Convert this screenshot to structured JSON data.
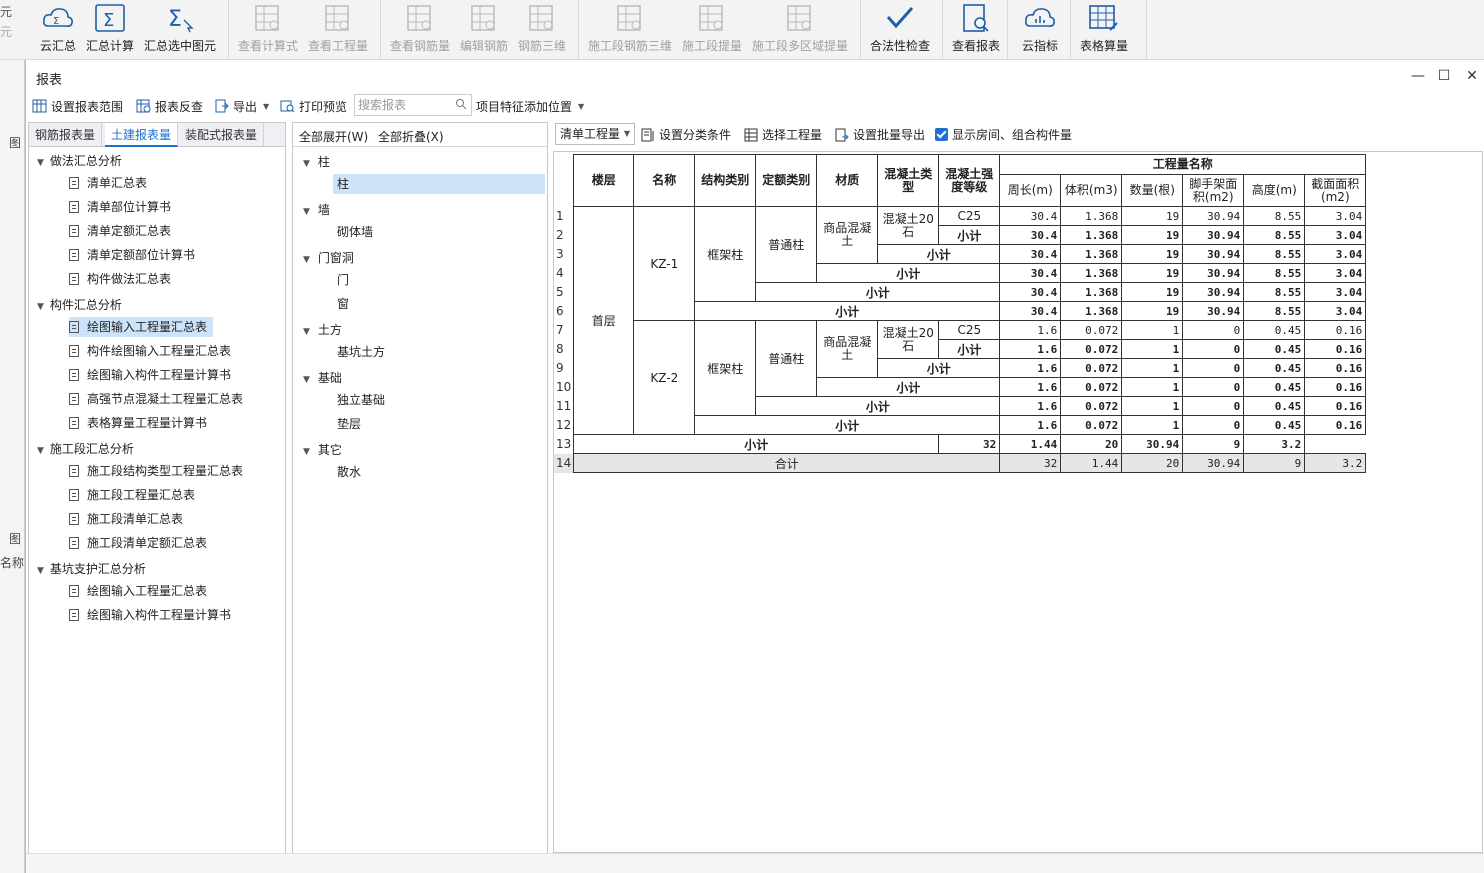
{
  "ribbon": {
    "edge_top": "元",
    "edge_bottom": "元",
    "buttons": [
      {
        "label": "云汇总",
        "icon": "cloud-sum-icon",
        "disabled": false
      },
      {
        "label": "汇总计算",
        "icon": "sigma-icon",
        "disabled": false
      },
      {
        "label": "汇总选中图元",
        "icon": "sigma-select-icon",
        "disabled": false
      },
      {
        "label": "查看计算式",
        "icon": "formula-view-icon",
        "disabled": true
      },
      {
        "label": "查看工程量",
        "icon": "quantity-view-icon",
        "disabled": true
      },
      {
        "label": "查看钢筋量",
        "icon": "rebar-view-icon",
        "disabled": true
      },
      {
        "label": "编辑钢筋",
        "icon": "edit-rebar-icon",
        "disabled": true
      },
      {
        "label": "钢筋三维",
        "icon": "rebar-3d-icon",
        "disabled": true
      },
      {
        "label": "施工段钢筋三维",
        "icon": "stage-rebar-3d-icon",
        "disabled": true
      },
      {
        "label": "施工段提量",
        "icon": "stage-quantity-icon",
        "disabled": true
      },
      {
        "label": "施工段多区域提量",
        "icon": "stage-multi-area-icon",
        "disabled": true
      },
      {
        "label": "合法性检查",
        "icon": "check-icon",
        "disabled": false
      },
      {
        "label": "查看报表",
        "icon": "report-view-icon",
        "disabled": false
      },
      {
        "label": "云指标",
        "icon": "cloud-index-icon",
        "disabled": false
      },
      {
        "label": "表格算量",
        "icon": "table-calc-icon",
        "disabled": false
      }
    ],
    "accent": "#1f6fd0"
  },
  "bg_strip": {
    "label_a": "图",
    "label_b": "图",
    "label_c": "名称"
  },
  "dialog": {
    "title": "报表",
    "toolbar": {
      "set_range": "设置报表范围",
      "reverse_check": "报表反查",
      "export": "导出",
      "print_preview": "打印预览",
      "search_placeholder": "搜索报表",
      "feature_position": "项目特征添加位置"
    },
    "tabs": [
      "钢筋报表量",
      "土建报表量",
      "装配式报表量"
    ],
    "tree": [
      {
        "group": "做法汇总分析",
        "items": [
          "清单汇总表",
          "清单部位计算书",
          "清单定额汇总表",
          "清单定额部位计算书",
          "构件做法汇总表"
        ]
      },
      {
        "group": "构件汇总分析",
        "items": [
          "绘图输入工程量汇总表",
          "构件绘图输入工程量汇总表",
          "绘图输入构件工程量计算书",
          "高强节点混凝土工程量汇总表",
          "表格算量工程量计算书"
        ]
      },
      {
        "group": "施工段汇总分析",
        "items": [
          "施工段结构类型工程量汇总表",
          "施工段工程量汇总表",
          "施工段清单汇总表",
          "施工段清单定额汇总表"
        ]
      },
      {
        "group": "基坑支护汇总分析",
        "items": [
          "绘图输入工程量汇总表",
          "绘图输入构件工程量计算书"
        ]
      }
    ],
    "mid": {
      "expand_all": "全部展开(W)",
      "collapse_all": "全部折叠(X)",
      "tree": [
        {
          "group": "柱",
          "items": [
            "柱"
          ]
        },
        {
          "group": "墙",
          "items": [
            "砌体墙"
          ]
        },
        {
          "group": "门窗洞",
          "items": [
            "门",
            "窗"
          ]
        },
        {
          "group": "土方",
          "items": [
            "基坑土方"
          ]
        },
        {
          "group": "基础",
          "items": [
            "独立基础",
            "垫层"
          ]
        },
        {
          "group": "其它",
          "items": [
            "散水"
          ]
        }
      ]
    },
    "right_toolbar": {
      "qty_select": "清单工程量",
      "set_class": "设置分类条件",
      "select_qty": "选择工程量",
      "batch_export": "设置批量导出",
      "show_rooms": "显示房间、组合构件量"
    },
    "table": {
      "headers": {
        "floor": "楼层",
        "name": "名称",
        "struct_type": "结构类别",
        "quota_type": "定额类别",
        "material": "材质",
        "concrete_type": "混凝土类型",
        "concrete_grade": "混凝土强度等级",
        "qty_group": "工程量名称",
        "perimeter": "周长(m)",
        "volume": "体积(m3)",
        "count": "数量(根)",
        "scaffold": "脚手架面积(m2)",
        "height": "高度(m)",
        "section": "截面面积(m2)"
      },
      "floor": "首层",
      "subtotal": "小计",
      "total_label": "合计",
      "groups": [
        {
          "name": "KZ-1",
          "struct": "框架柱",
          "quota": "普通柱",
          "material": "商品混凝土",
          "ctype": "混凝土20石",
          "grade": "C25",
          "vals": [
            "30.4",
            "1.368",
            "19",
            "30.94",
            "8.55",
            "3.04"
          ]
        },
        {
          "name": "KZ-2",
          "struct": "框架柱",
          "quota": "普通柱",
          "material": "商品混凝土",
          "ctype": "混凝土20石",
          "grade": "C25",
          "vals": [
            "1.6",
            "0.072",
            "1",
            "0",
            "0.45",
            "0.16"
          ]
        }
      ],
      "floor_subtotal": [
        "32",
        "1.44",
        "20",
        "30.94",
        "9",
        "3.2"
      ],
      "grand_total": [
        "32",
        "1.44",
        "20",
        "30.94",
        "9",
        "3.2"
      ],
      "row_numbers": [
        "1",
        "2",
        "3",
        "4",
        "5",
        "6",
        "7",
        "8",
        "9",
        "10",
        "11",
        "12",
        "13",
        "14"
      ]
    }
  }
}
